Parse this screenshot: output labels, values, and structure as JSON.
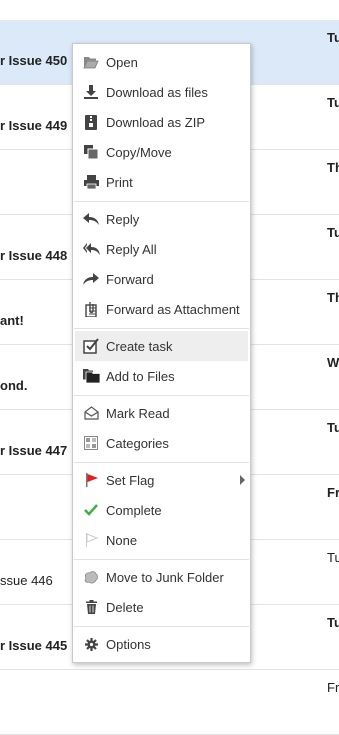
{
  "messages": [
    {
      "subject": "r Issue 450",
      "date": "Tu",
      "unread": true,
      "selected": true
    },
    {
      "subject": "r Issue 449",
      "date": "Tu",
      "unread": true
    },
    {
      "subject": "",
      "date": "Th",
      "unread": true
    },
    {
      "subject": "r Issue 448",
      "date": "Tu",
      "unread": true
    },
    {
      "subject": "ant!",
      "date": "Th",
      "unread": true
    },
    {
      "subject": "ond.",
      "date": "W",
      "unread": true
    },
    {
      "subject": "r Issue 447",
      "date": "Tu",
      "unread": true
    },
    {
      "subject": "",
      "date": "Fr",
      "unread": true
    },
    {
      "subject": "ssue 446",
      "date": "Tu",
      "unread": false
    },
    {
      "subject": "r Issue 445",
      "date": "Tu",
      "unread": true
    },
    {
      "subject": "",
      "date": "Fr",
      "unread": false
    }
  ],
  "menu": {
    "open": "Open",
    "download_files": "Download as files",
    "download_zip": "Download as ZIP",
    "copy_move": "Copy/Move",
    "print": "Print",
    "reply": "Reply",
    "reply_all": "Reply All",
    "forward": "Forward",
    "forward_attachment": "Forward as Attachment",
    "create_task": "Create task",
    "add_to_files": "Add to Files",
    "mark_read": "Mark Read",
    "categories": "Categories",
    "set_flag": "Set Flag",
    "complete": "Complete",
    "none": "None",
    "move_junk": "Move to Junk Folder",
    "delete": "Delete",
    "options": "Options"
  },
  "colors": {
    "selected_row": "#dbe9f9",
    "flag_red": "#e02020",
    "complete_green": "#3cb043",
    "icon_gray": "#555555"
  }
}
